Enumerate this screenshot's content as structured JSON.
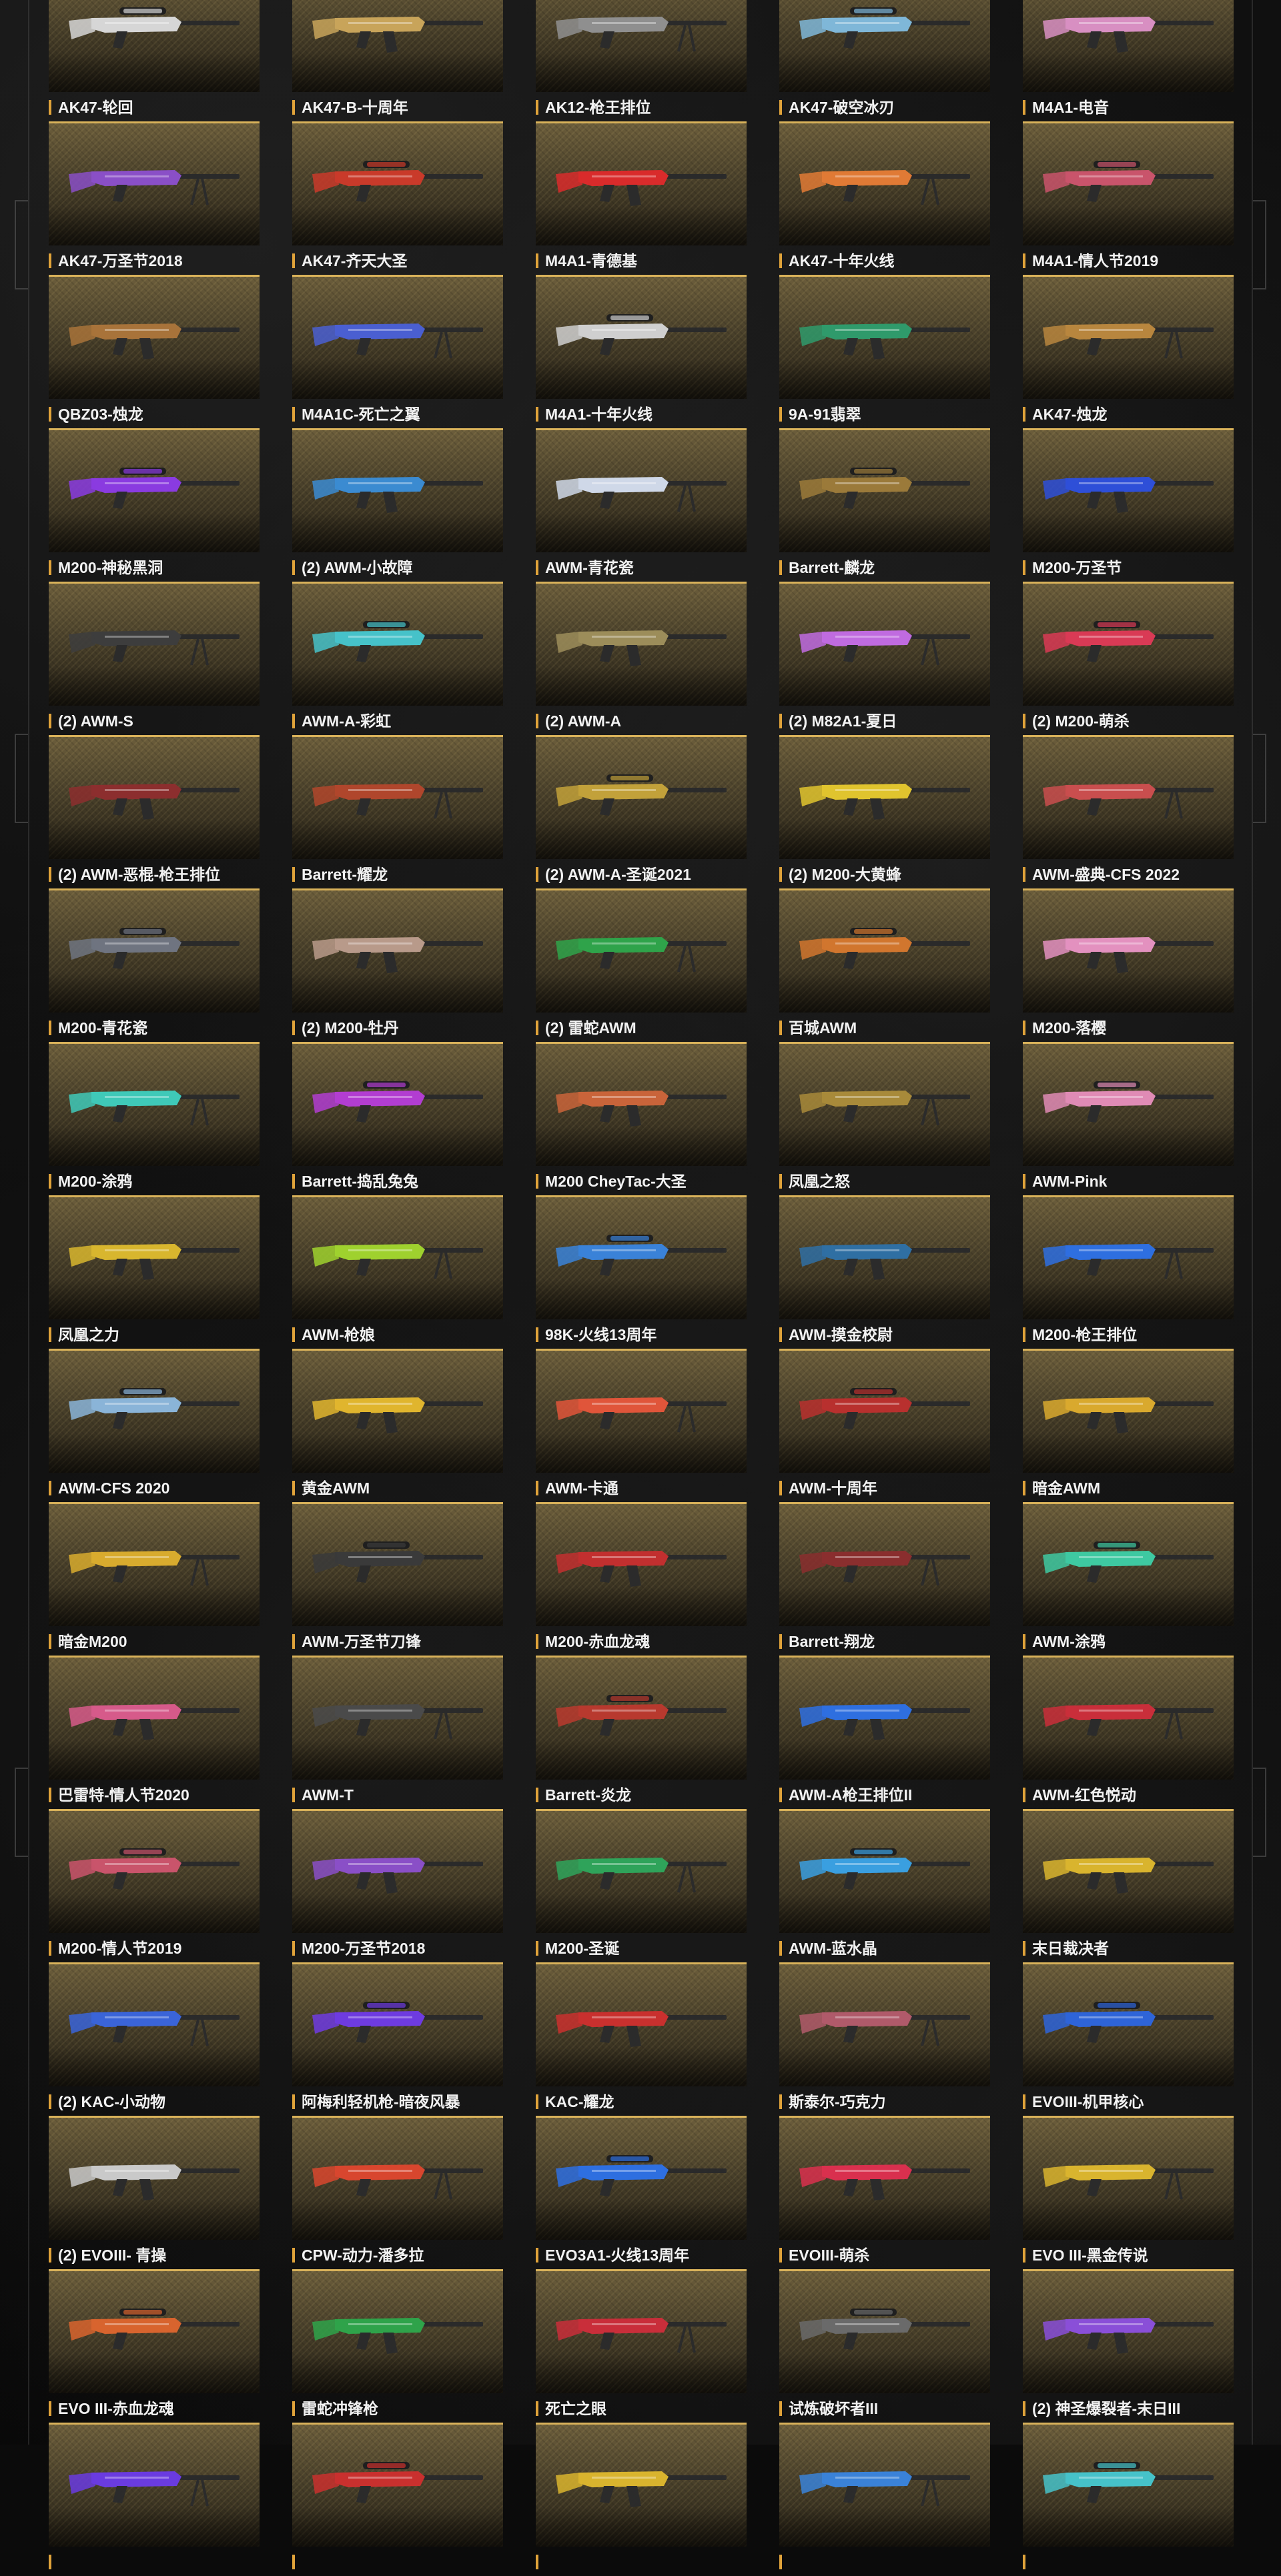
{
  "weapons": [
    {
      "name": "AK47-轮回",
      "color": "#d6d6d6"
    },
    {
      "name": "AK47-B-十周年",
      "color": "#c8a45a"
    },
    {
      "name": "AK12-枪王排位",
      "color": "#8f8f8f"
    },
    {
      "name": "AK47-破空冰刃",
      "color": "#7fb7d8"
    },
    {
      "name": "M4A1-电音",
      "color": "#d88fc2"
    },
    {
      "name": "AK47-万圣节2018",
      "color": "#8a4fc7"
    },
    {
      "name": "AK47-齐天大圣",
      "color": "#c93a2a"
    },
    {
      "name": "M4A1-青德基",
      "color": "#d92b2b"
    },
    {
      "name": "AK47-十年火线",
      "color": "#e07a35"
    },
    {
      "name": "M4A1-情人节2019",
      "color": "#c9546b"
    },
    {
      "name": "QBZ03-烛龙",
      "color": "#a8733a"
    },
    {
      "name": "M4A1C-死亡之翼",
      "color": "#4a5fd1"
    },
    {
      "name": "M4A1-十年火线",
      "color": "#cfcfcf"
    },
    {
      "name": "9A-91翡翠",
      "color": "#2f9a6b"
    },
    {
      "name": "AK47-烛龙",
      "color": "#b8863e"
    },
    {
      "name": "M200-神秘黑洞",
      "color": "#8a3be0"
    },
    {
      "name": "(2) AWM-小故障",
      "color": "#3b8bd1"
    },
    {
      "name": "AWM-青花瓷",
      "color": "#cfd8e8"
    },
    {
      "name": "Barrett-麟龙",
      "color": "#9b7a3a"
    },
    {
      "name": "M200-万圣节",
      "color": "#2e4fd8"
    },
    {
      "name": "(2) AWM-S",
      "color": "#3d3d3d"
    },
    {
      "name": "AWM-A-彩虹",
      "color": "#46c2c9"
    },
    {
      "name": "(2) AWM-A",
      "color": "#9c8d5a"
    },
    {
      "name": "(2) M82A1-夏日",
      "color": "#c06be0"
    },
    {
      "name": "(2) M200-萌杀",
      "color": "#d93a55"
    },
    {
      "name": "(2) AWM-恶棍-枪王排位",
      "color": "#8c2e2e"
    },
    {
      "name": "Barrett-耀龙",
      "color": "#b0462c"
    },
    {
      "name": "(2) AWM-A-圣诞2021",
      "color": "#c2a13a"
    },
    {
      "name": "(2) M200-大黄蜂",
      "color": "#e0c42e"
    },
    {
      "name": "AWM-盛典-CFS 2022",
      "color": "#c94e4e"
    },
    {
      "name": "M200-青花瓷",
      "color": "#6f7480"
    },
    {
      "name": "(2) M200-牡丹",
      "color": "#b89a8a"
    },
    {
      "name": "(2) 雷蛇AWM",
      "color": "#2fa34a"
    },
    {
      "name": "百城AWM",
      "color": "#d1762e"
    },
    {
      "name": "M200-落樱",
      "color": "#e391bf"
    },
    {
      "name": "M200-涂鸦",
      "color": "#3fc9b8"
    },
    {
      "name": "Barrett-捣乱兔兔",
      "color": "#b23dd1"
    },
    {
      "name": "M200 CheyTac-大圣",
      "color": "#c9643a"
    },
    {
      "name": "凤凰之怒",
      "color": "#a88a3a"
    },
    {
      "name": "AWM-Pink",
      "color": "#e08bb5"
    },
    {
      "name": "凤凰之力",
      "color": "#d8b62e"
    },
    {
      "name": "AWM-枪娘",
      "color": "#9fd12e"
    },
    {
      "name": "98K-火线13周年",
      "color": "#3a82d8"
    },
    {
      "name": "AWM-摸金校尉",
      "color": "#2f6fa3"
    },
    {
      "name": "M200-枪王排位",
      "color": "#2e6fe0"
    },
    {
      "name": "AWM-CFS 2020",
      "color": "#8ab4d8"
    },
    {
      "name": "黄金AWM",
      "color": "#e0b52e"
    },
    {
      "name": "AWM-卡通",
      "color": "#e0553a"
    },
    {
      "name": "AWM-十周年",
      "color": "#b8302e"
    },
    {
      "name": "暗金AWM",
      "color": "#d9a92e"
    },
    {
      "name": "暗金M200",
      "color": "#d8ab2e"
    },
    {
      "name": "AWM-万圣节刀锋",
      "color": "#3a3a3a"
    },
    {
      "name": "M200-赤血龙魂",
      "color": "#c22f2f"
    },
    {
      "name": "Barrett-翔龙",
      "color": "#8a2e2e"
    },
    {
      "name": "AWM-涂鸦",
      "color": "#3ec9a1"
    },
    {
      "name": "巴雷特-情人节2020",
      "color": "#d65a8a"
    },
    {
      "name": "AWM-T",
      "color": "#4a4a4a"
    },
    {
      "name": "Barrett-炎龙",
      "color": "#b8392e"
    },
    {
      "name": "AWM-A枪王排位II",
      "color": "#2e6fe0"
    },
    {
      "name": "AWM-红色悦动",
      "color": "#c92e3a"
    },
    {
      "name": "M200-情人节2019",
      "color": "#c9546b"
    },
    {
      "name": "M200-万圣节2018",
      "color": "#8a4fc7"
    },
    {
      "name": "M200-圣诞",
      "color": "#2fa35a"
    },
    {
      "name": "AWM-蓝水晶",
      "color": "#3a9fe0"
    },
    {
      "name": "末日裁决者",
      "color": "#d9b42e"
    },
    {
      "name": "(2) KAC-小动物",
      "color": "#3a64d8"
    },
    {
      "name": "阿梅利轻机枪-暗夜风暴",
      "color": "#6e3be0"
    },
    {
      "name": "KAC-耀龙",
      "color": "#c9302e"
    },
    {
      "name": "斯泰尔-巧克力",
      "color": "#b05a6a"
    },
    {
      "name": "EVOIII-机甲核心",
      "color": "#2e64d8"
    },
    {
      "name": "(2) EVOIII- 青操",
      "color": "#c9c9c9"
    },
    {
      "name": "CPW-动力-潘多拉",
      "color": "#d8462e"
    },
    {
      "name": "EVO3A1-火线13周年",
      "color": "#2e6fe0"
    },
    {
      "name": "EVOIII-萌杀",
      "color": "#d9304e"
    },
    {
      "name": "EVO III-黑金传说",
      "color": "#d9b42e"
    },
    {
      "name": "EVO III-赤血龙魂",
      "color": "#d8642e"
    },
    {
      "name": "雷蛇冲锋枪",
      "color": "#2fa34a"
    },
    {
      "name": "死亡之眼",
      "color": "#c92e3a"
    },
    {
      "name": "试炼破坏者III",
      "color": "#6a6a6a"
    },
    {
      "name": "(2) 神圣爆裂者-末日III",
      "color": "#8a4fd8"
    },
    {
      "name": "",
      "color": "#6a3be0"
    },
    {
      "name": "",
      "color": "#c9302e"
    },
    {
      "name": "",
      "color": "#d9b42e"
    },
    {
      "name": "",
      "color": "#3a82d8"
    },
    {
      "name": "",
      "color": "#46c2c9"
    }
  ]
}
